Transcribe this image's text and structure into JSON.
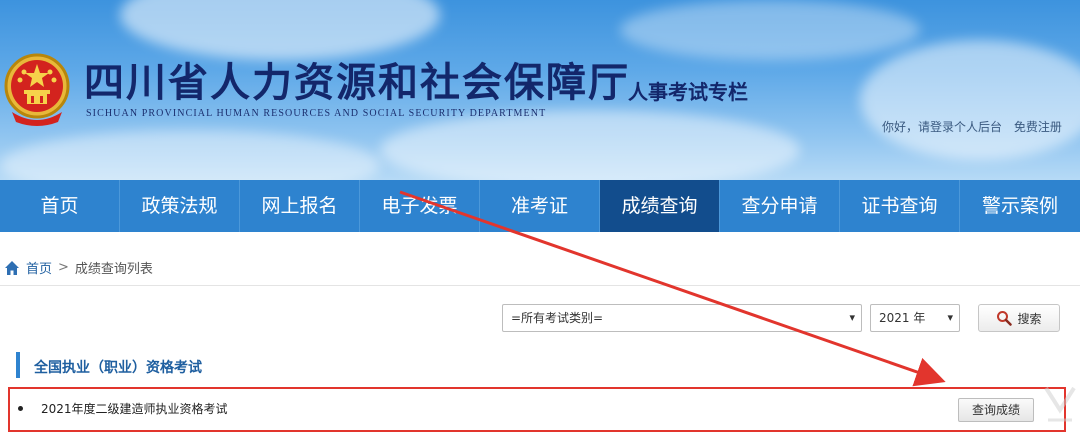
{
  "header": {
    "org_name": "四川省人力资源和社会保障厅",
    "org_name_en": "SICHUAN PROVINCIAL HUMAN RESOURCES AND SOCIAL SECURITY DEPARTMENT",
    "subtitle": "人事考试专栏",
    "login_text": "你好，请登录个人后台",
    "register_text": "免费注册"
  },
  "nav": {
    "items": [
      "首页",
      "政策法规",
      "网上报名",
      "电子发票",
      "准考证",
      "成绩查询",
      "查分申请",
      "证书查询",
      "警示案例"
    ],
    "active": "成绩查询"
  },
  "breadcrumb": {
    "home": "首页",
    "separator": ">",
    "current": "成绩查询列表"
  },
  "filters": {
    "category_value": "=所有考试类别=",
    "year_value": "2021 年",
    "search_label": "搜索"
  },
  "section": {
    "title": "全国执业（职业）资格考试",
    "items": [
      {
        "name": "2021年度二级建造师执业资格考试",
        "action": "查询成绩"
      }
    ]
  },
  "colors": {
    "nav_bg": "#2e83cf",
    "nav_active": "#124d8d",
    "title_navy": "#13276b",
    "highlight_red": "#e2352d"
  },
  "icons": [
    "national-emblem-icon",
    "home-icon",
    "search-icon",
    "chevron-down-icon",
    "annotation-arrow"
  ]
}
